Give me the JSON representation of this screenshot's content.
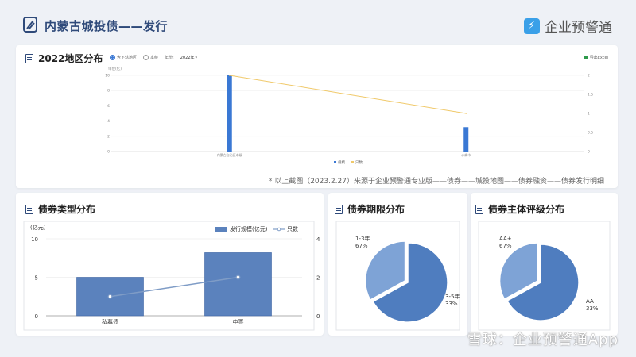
{
  "header": {
    "title": "内蒙古城投债——发行",
    "brand": "企业预警通",
    "brand_icon": "lightning-icon"
  },
  "top_panel": {
    "title": "2022地区分布",
    "radio_options": [
      "含下辖地区",
      "本级"
    ],
    "year_label": "年份:",
    "year_value": "2022年",
    "export_label": "导出Excel",
    "note": "* 以上截图（2023.2.27）来源于企业预警通专业版——债券——城投地图——债券融资——债券发行明细"
  },
  "type_panel": {
    "title": "债券类型分布"
  },
  "term_panel": {
    "title": "债券期限分布"
  },
  "rating_panel": {
    "title": "债券主体评级分布"
  },
  "watermark": "雪球：企业预警通App",
  "chart_data": [
    {
      "type": "bar",
      "title": "2022地区分布",
      "ylabel": "单位(亿)",
      "categories": [
        "内蒙古自治区本级",
        "赤峰市"
      ],
      "series": [
        {
          "name": "规模",
          "values": [
            10,
            3.2
          ],
          "kind": "bar",
          "axis": "left",
          "color": "#3a78d4"
        },
        {
          "name": "只数",
          "values": [
            2,
            1
          ],
          "kind": "line",
          "axis": "right",
          "color": "#f0c96a"
        }
      ],
      "ylim": [
        0,
        10
      ],
      "y2lim": [
        0,
        2
      ],
      "yticks": [
        0,
        2,
        4,
        6,
        8,
        10
      ],
      "y2ticks": [
        0,
        0.5,
        1,
        1.5,
        2
      ],
      "legend": "bottom"
    },
    {
      "type": "bar",
      "title": "债券类型分布",
      "ylabel": "(亿元)",
      "categories": [
        "私募债",
        "中票"
      ],
      "series": [
        {
          "name": "发行规模(亿元)",
          "values": [
            5,
            8.2
          ],
          "kind": "bar",
          "axis": "left",
          "color": "#5b82bd"
        },
        {
          "name": "只数",
          "values": [
            1,
            2
          ],
          "kind": "line",
          "axis": "right",
          "color": "#7f9cc6"
        }
      ],
      "ylim": [
        0,
        10
      ],
      "y2lim": [
        0,
        4
      ],
      "yticks": [
        0,
        5,
        10
      ],
      "y2ticks": [
        0,
        2,
        4
      ],
      "legend": "top-right"
    },
    {
      "type": "pie",
      "title": "债券期限分布",
      "slices": [
        {
          "label": "1-3年",
          "pct": "67%",
          "value": 67,
          "color": "#4f7dbf"
        },
        {
          "label": "3-5年",
          "pct": "33%",
          "value": 33,
          "color": "#7ea3d6"
        }
      ]
    },
    {
      "type": "pie",
      "title": "债券主体评级分布",
      "slices": [
        {
          "label": "AA+",
          "pct": "67%",
          "value": 67,
          "color": "#4f7dbf"
        },
        {
          "label": "AA",
          "pct": "33%",
          "value": 33,
          "color": "#7ea3d6"
        }
      ]
    }
  ]
}
